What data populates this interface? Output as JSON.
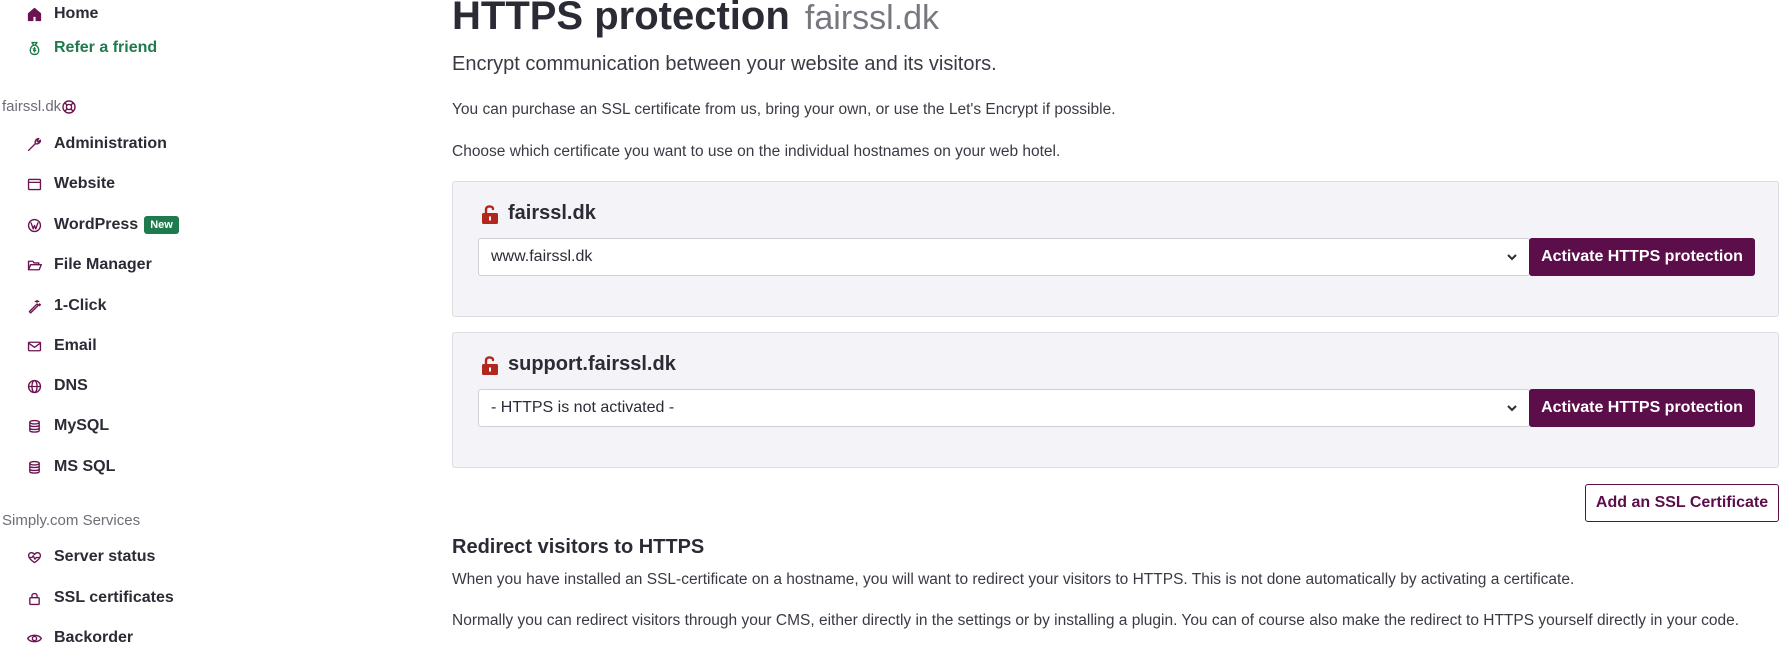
{
  "sidebar": {
    "top_items": [
      {
        "label": "Home",
        "icon": "home-icon"
      },
      {
        "label": "Refer a friend",
        "icon": "money-bag-icon",
        "color": "#1f7a4d"
      }
    ],
    "account_title": "fairssl.dk",
    "account_items": [
      {
        "label": "Administration",
        "icon": "wrench-icon"
      },
      {
        "label": "Website",
        "icon": "browser-window-icon"
      },
      {
        "label": "WordPress",
        "icon": "wordpress-icon",
        "badge": "New"
      },
      {
        "label": "File Manager",
        "icon": "folder-open-icon"
      },
      {
        "label": "1-Click",
        "icon": "magic-wand-icon"
      },
      {
        "label": "Email",
        "icon": "envelope-icon"
      },
      {
        "label": "DNS",
        "icon": "globe-icon"
      },
      {
        "label": "MySQL",
        "icon": "database-icon"
      },
      {
        "label": "MS SQL",
        "icon": "database-icon"
      }
    ],
    "services_title": "Simply.com Services",
    "services_items": [
      {
        "label": "Server status",
        "icon": "heart-pulse-icon"
      },
      {
        "label": "SSL certificates",
        "icon": "lock-icon"
      },
      {
        "label": "Backorder",
        "icon": "eye-icon"
      }
    ]
  },
  "main": {
    "title": "HTTPS protection",
    "title_domain": "fairssl.dk",
    "subtitle": "Encrypt communication between your website and its visitors.",
    "intro_1": "You can purchase an SSL certificate from us, bring your own, or use the Let's Encrypt if possible.",
    "intro_2": "Choose which certificate you want to use on the individual hostnames on your web hotel.",
    "cards": [
      {
        "hostname": "fairssl.dk",
        "selected": "www.fairssl.dk",
        "button": "Activate HTTPS protection"
      },
      {
        "hostname": "support.fairssl.dk",
        "selected": "- HTTPS is not activated -",
        "button": "Activate HTTPS protection"
      }
    ],
    "add_certificate_button": "Add an SSL Certificate",
    "redirect_heading": "Redirect visitors to HTTPS",
    "redirect_p1": "When you have installed an SSL-certificate on a hostname, you will want to redirect your visitors to HTTPS. This is not done automatically by activating a certificate.",
    "redirect_p2": "Normally you can redirect visitors through your CMS, either directly in the settings or by installing a plugin. You can of course also make the redirect to HTTPS yourself directly in your code."
  },
  "colors": {
    "brand": "#5c0e4a",
    "green": "#1f7a4d",
    "lock_red": "#b3261e",
    "card_bg": "#f4f4f8"
  }
}
